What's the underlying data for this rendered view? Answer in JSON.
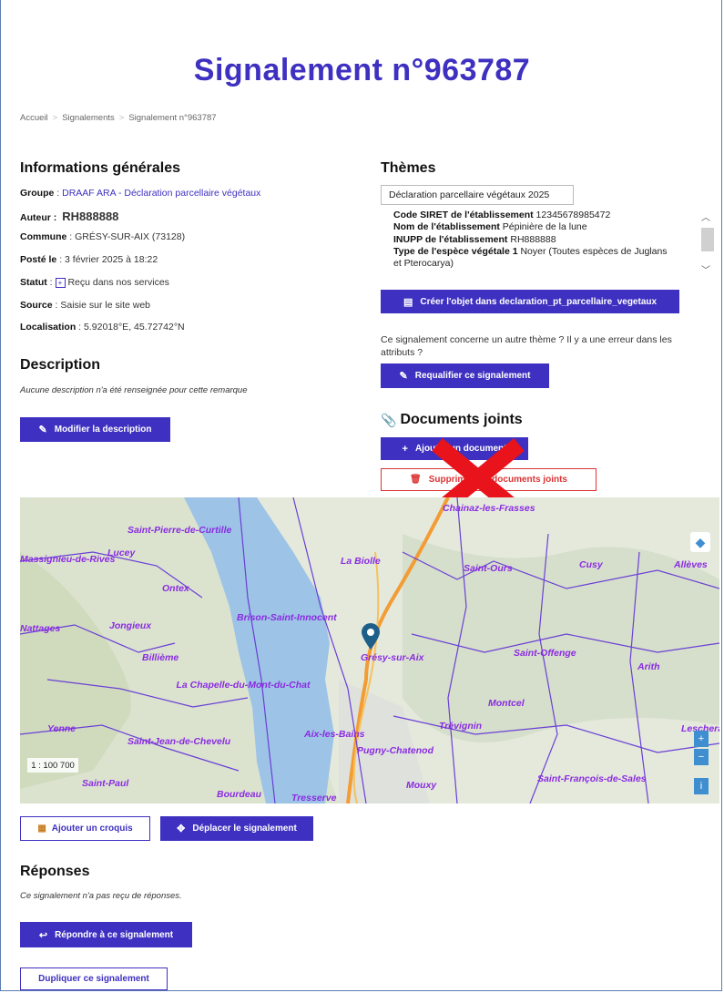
{
  "page": {
    "title": "Signalement n°963787",
    "breadcrumb": [
      "Accueil",
      "Signalements",
      "Signalement n°963787"
    ]
  },
  "info": {
    "heading": "Informations générales",
    "groupe_label": "Groupe",
    "groupe_value": "DRAAF ARA - Déclaration parcellaire végétaux",
    "auteur_label": "Auteur :",
    "auteur_value": "RH888888",
    "commune_label": "Commune",
    "commune_value": "GRÉSY-SUR-AIX (73128)",
    "poste_label": "Posté le",
    "poste_value": "3 février 2025 à 18:22",
    "statut_label": "Statut",
    "statut_value": "Reçu dans nos services",
    "source_label": "Source",
    "source_value": "Saisie sur le site web",
    "localisation_label": "Localisation",
    "localisation_value": "5.92018°E, 45.72742°N"
  },
  "description": {
    "heading": "Description",
    "text": "Aucune description n'a été renseignée pour cette remarque",
    "button": "Modifier la description"
  },
  "themes": {
    "heading": "Thèmes",
    "selected": "Déclaration parcellaire végétaux 2025",
    "attributes": [
      {
        "label": "Code SIRET de l'établissement",
        "value": "12345678985472"
      },
      {
        "label": "Nom de l'établissement",
        "value": "Pépinière de la lune"
      },
      {
        "label": "INUPP de l'établissement",
        "value": "RH888888"
      },
      {
        "label": "Type de l'espèce végétale 1",
        "value": "Noyer (Toutes espèces de Juglans et Pterocarya)"
      }
    ],
    "create_button": "Créer l'objet dans declaration_pt_parcellaire_vegetaux",
    "requalify_text": "Ce signalement concerne un autre thème ? Il y a une erreur dans les attributs ?",
    "requalify_button": "Requalifier ce signalement"
  },
  "documents": {
    "heading": "Documents joints",
    "add_button": "Ajouter un document",
    "delete_button": "Supprimer les documents joints"
  },
  "map": {
    "scale": "1 : 100 700",
    "labels": [
      "Saint-Pierre-de-Curtille",
      "Lucey",
      "La Biolle",
      "Saint-Ours",
      "Cusy",
      "Ontex",
      "Brison-Saint-Innocent",
      "Jongieux",
      "Billième",
      "Grésy-sur-Aix",
      "Saint-Offenge",
      "Arith",
      "La Chapelle-du-Mont-du-Chat",
      "Montcel",
      "Trévignin",
      "Aix-les-Bains",
      "Saint-Jean-de-Chevelu",
      "Pugny-Chatenod",
      "Mouxy",
      "Saint-François-de-Sales",
      "Bourdeau",
      "Tresserve",
      "Yenne",
      "Saint-Paul",
      "Chainaz-les-Frasses",
      "Massignieu-de-Rives",
      "Nattages",
      "Lescheraines",
      "Allèves"
    ]
  },
  "map_actions": {
    "croquis_button": "Ajouter un croquis",
    "move_button": "Déplacer le signalement"
  },
  "responses": {
    "heading": "Réponses",
    "text": "Ce signalement n'a pas reçu de réponses.",
    "reply_button": "Répondre à ce signalement",
    "duplicate_button": "Dupliquer ce signalement"
  },
  "colors": {
    "accent": "#3e30c0",
    "danger": "#d33333",
    "overlay_cross": "#e8131b"
  }
}
